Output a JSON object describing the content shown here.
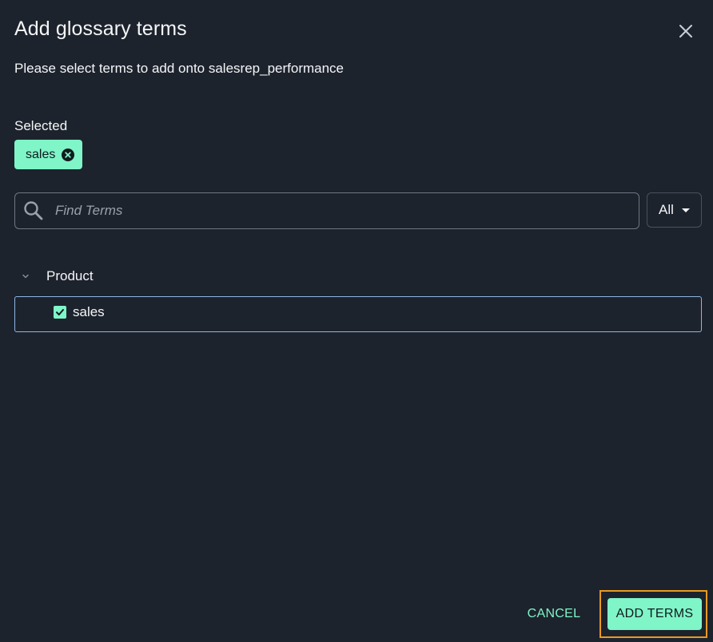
{
  "dialog": {
    "title": "Add glossary terms",
    "subtitle": "Please select terms to add onto salesrep_performance",
    "close_icon": "close-icon"
  },
  "selected": {
    "label": "Selected",
    "chips": [
      "sales"
    ]
  },
  "search": {
    "placeholder": "Find Terms",
    "value": "",
    "icon": "search-icon"
  },
  "filter": {
    "selected": "All"
  },
  "tree": {
    "group_label": "Product",
    "group_expanded": true,
    "terms": [
      {
        "label": "sales",
        "checked": true
      }
    ]
  },
  "actions": {
    "cancel_label": "CANCEL",
    "add_label": "ADD TERMS"
  },
  "colors": {
    "background": "#1d232d",
    "accent": "#7ff5c8",
    "focus_outline": "#e89a21",
    "row_border": "#8fb6e3"
  }
}
